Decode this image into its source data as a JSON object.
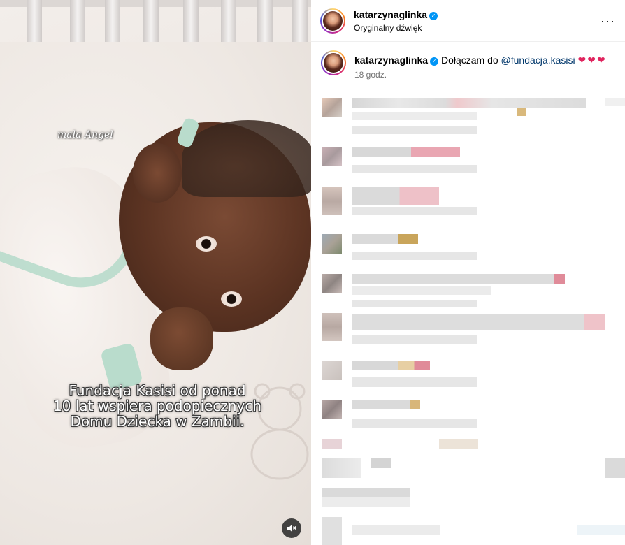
{
  "post": {
    "author": "katarzynaglinka",
    "audio_label": "Oryginalny dźwięk",
    "verified_icon": "verified-badge-icon",
    "more_icon": "more-options-icon",
    "more_glyph": "···"
  },
  "media": {
    "handwritten_tag": "mała Angel",
    "overlay_lines": [
      "Fundacja Kasisi od ponad",
      "10 lat wspiera podopiecznych",
      "Domu Dziecka w Zambii."
    ],
    "mute_icon": "speaker-muted-icon"
  },
  "caption": {
    "author": "katarzynaglinka",
    "text": "Dołączam do",
    "mention": "@fundacja.kasisi",
    "hearts": "❤❤❤",
    "time": "18 godz."
  },
  "colors": {
    "accent_blue": "#0095f6",
    "mention_blue": "#00376b",
    "heart_red": "#e0245e",
    "muted_text": "#737373"
  }
}
